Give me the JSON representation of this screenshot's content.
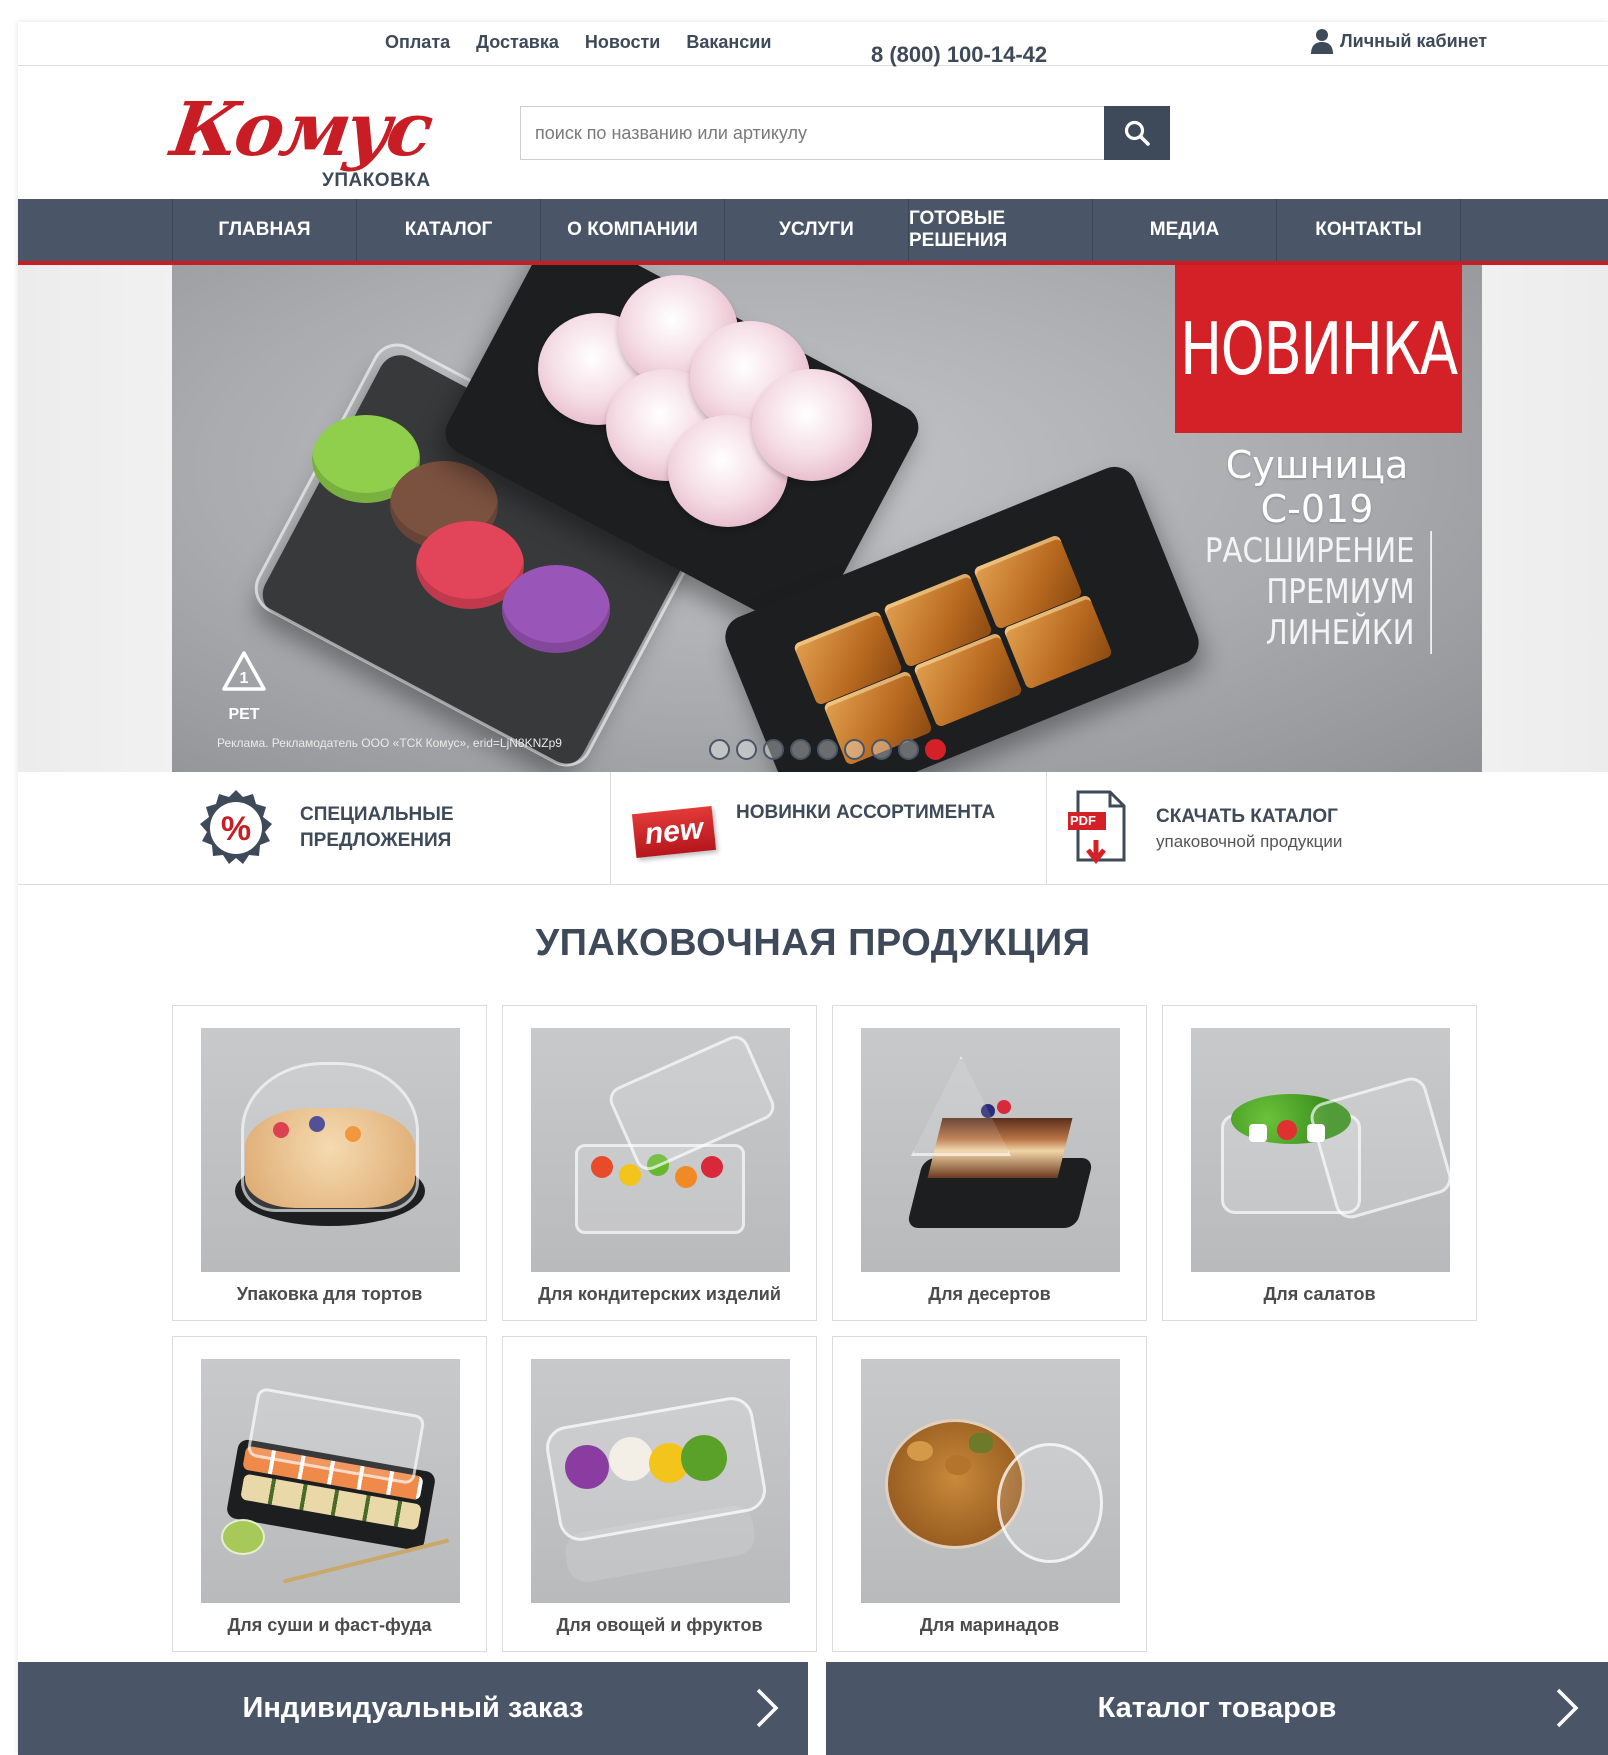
{
  "topbar": {
    "links": [
      "Оплата",
      "Доставка",
      "Новости",
      "Вакансии"
    ],
    "phone": "8 (800) 100-14-42",
    "account_label": "Личный кабинет"
  },
  "header": {
    "logo_text": "Комус",
    "logo_sub": "УПАКОВКА",
    "search_placeholder": "поиск по названию или артикулу"
  },
  "nav": {
    "items": [
      "ГЛАВНАЯ",
      "КАТАЛОГ",
      "О КОМПАНИИ",
      "УСЛУГИ",
      "ГОТОВЫЕ РЕШЕНИЯ",
      "МЕДИА",
      "КОНТАКТЫ"
    ]
  },
  "banner": {
    "badge": "НОВИНКА",
    "product": "Сушница С-019",
    "ext_line1": "РАСШИРЕНИЕ",
    "ext_line2": "ПРЕМИУМ",
    "ext_line3": "ЛИНЕЙКИ",
    "pet_number": "1",
    "pet_label": "PET",
    "ad_note": "Реклама. Рекламодатель ООО «ТСК Комус», erid=LjN8KNZp9",
    "slides_count": 9,
    "active_slide": 9
  },
  "features": {
    "special_line1": "СПЕЦИАЛЬНЫЕ",
    "special_line2": "ПРЕДЛОЖЕНИЯ",
    "new_badge": "new",
    "new_title": "НОВИНКИ АССОРТИМЕНТА",
    "pdf_badge": "PDF",
    "catalog_title": "СКАЧАТЬ КАТАЛОГ",
    "catalog_sub": "упаковочной продукции"
  },
  "section": {
    "title": "УПАКОВОЧНАЯ ПРОДУКЦИЯ",
    "cards": [
      "Упаковка для тортов",
      "Для кондитерских изделий",
      "Для десертов",
      "Для салатов",
      "Для суши и фаст-фуда",
      "Для овощей и фруктов",
      "Для маринадов"
    ]
  },
  "bottom": {
    "custom_order": "Индивидуальный заказ",
    "catalog": "Каталог товаров"
  },
  "colors": {
    "brand_red": "#c81d25",
    "nav_slate": "#4a5667",
    "text_dark": "#3e4a59"
  }
}
